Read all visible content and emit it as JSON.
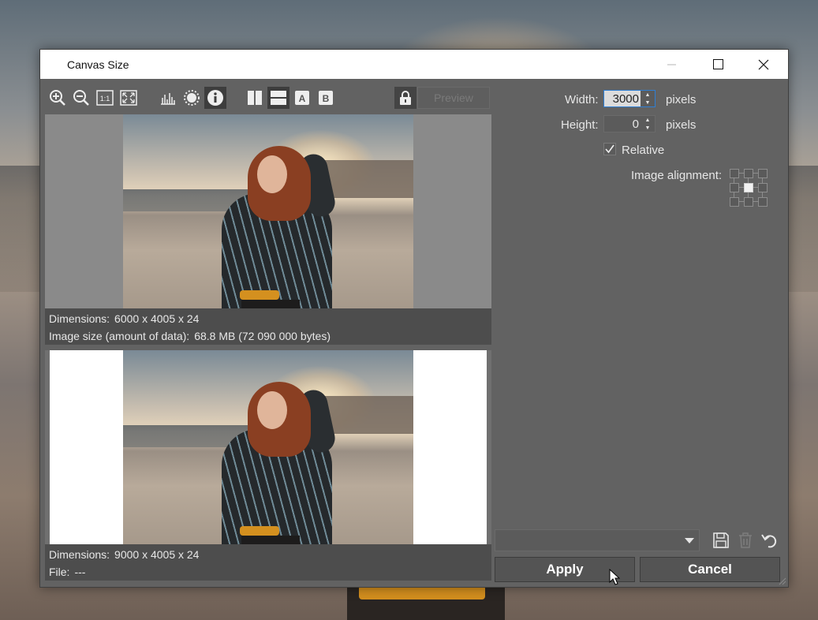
{
  "window": {
    "title": "Canvas Size"
  },
  "toolbar": {
    "tools": [
      "zoom-in-icon",
      "zoom-out-icon",
      "actual-size-icon",
      "fit-to-window-icon",
      "histogram-icon",
      "brightness-icon",
      "info-icon",
      "split-vertical-icon",
      "split-horizontal-icon",
      "a-icon",
      "b-icon"
    ],
    "preview_label": "Preview",
    "one_to_one_text": "1:1",
    "a_text": "A",
    "b_text": "B"
  },
  "original": {
    "dimensions_label": "Dimensions:",
    "dimensions_value": "6000 x 4005 x 24",
    "size_label": "Image size (amount of data):",
    "size_value": "68.8 MB (72 090 000 bytes)"
  },
  "result": {
    "dimensions_label": "Dimensions:",
    "dimensions_value": "9000 x 4005 x 24",
    "file_label": "File:",
    "file_value": "---"
  },
  "settings": {
    "width_label": "Width:",
    "width_value": "3000",
    "height_label": "Height:",
    "height_value": "0",
    "unit": "pixels",
    "relative_label": "Relative",
    "relative_checked": true,
    "alignment_label": "Image alignment:",
    "alignment_selected": "center"
  },
  "preset": {
    "value": ""
  },
  "buttons": {
    "apply": "Apply",
    "cancel": "Cancel"
  },
  "colors": {
    "dialog_bg": "#626262",
    "info_bg": "#4d4d4d",
    "focus": "#2f7fd4"
  }
}
